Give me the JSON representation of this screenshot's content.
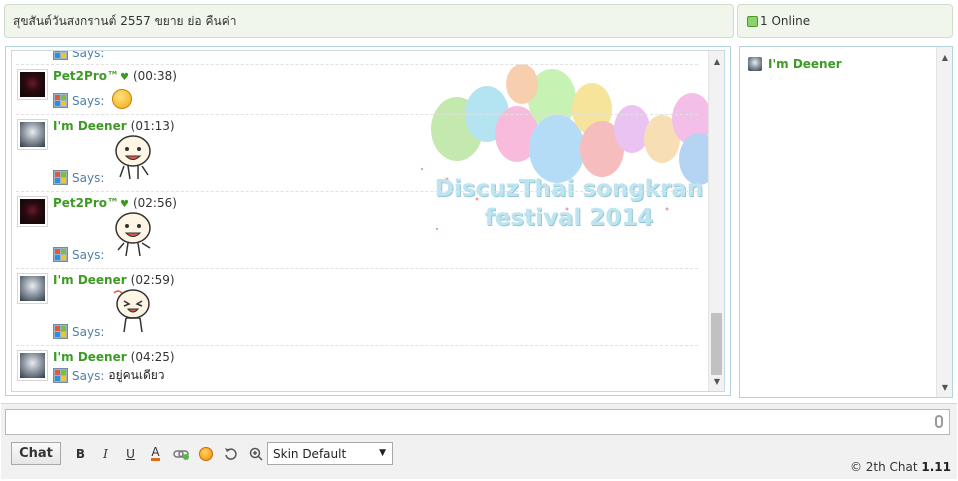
{
  "header": {
    "announcement": "สุขสันต์วันสงกรานต์ 2557 ขยาย ย่อ คืนค่า",
    "online_count": "1 Online"
  },
  "messages": [
    {
      "user": "Pet2Pro™",
      "heart": "♥",
      "time": "(00:38)",
      "says": "Says:",
      "text": ""
    },
    {
      "user": "I'm Deener",
      "time": "(01:13)",
      "says": "Says:",
      "text": ""
    },
    {
      "user": "Pet2Pro™",
      "heart": "♥",
      "time": "(02:56)",
      "says": "Says:",
      "text": ""
    },
    {
      "user": "I'm Deener",
      "time": "(02:59)",
      "says": "Says:",
      "text": ""
    },
    {
      "user": "I'm Deener",
      "time": "(04:25)",
      "says": "Says:",
      "text": "อยู่คนเดียว"
    }
  ],
  "banner": {
    "line1": "DiscuzThai songkran",
    "line2": "festival 2014"
  },
  "online_users": [
    {
      "name": "I'm Deener"
    }
  ],
  "toolbar": {
    "chat_label": "Chat",
    "bold": "B",
    "italic": "I",
    "underline": "U",
    "font_color": "A",
    "skin_selected": "Skin Default"
  },
  "footer": {
    "copyright": "© 2th Chat",
    "version": "1.11"
  },
  "colors": {
    "username": "#3d9b25",
    "says": "#4f7fa8",
    "header_bg": "#f0f6ec"
  }
}
